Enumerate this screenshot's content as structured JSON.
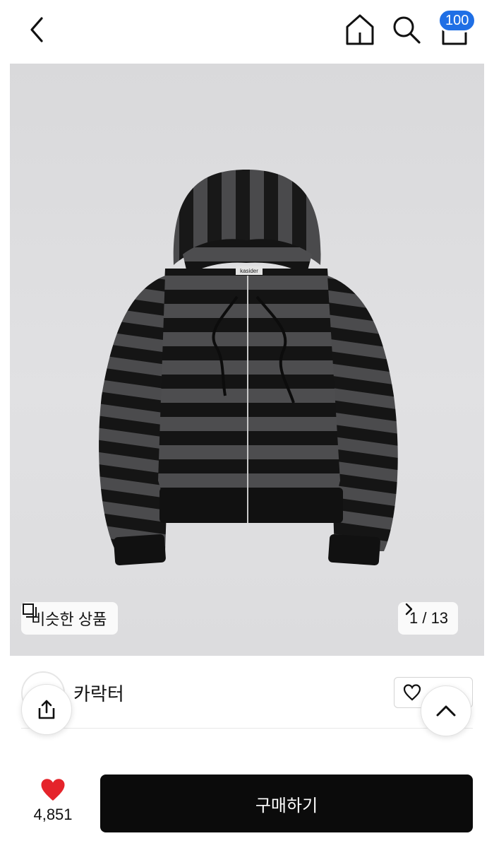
{
  "header": {
    "back_icon": "chevron-left-icon",
    "home_icon": "home-icon",
    "search_icon": "search-icon",
    "cart_icon": "cart-icon",
    "cart_badge": "100",
    "badge_color": "#1f6fe5"
  },
  "gallery": {
    "similar_label": "비슷한 상품",
    "page_indicator": "1 / 13",
    "tag_text": "kasider"
  },
  "brand": {
    "name": "카락터"
  },
  "colors": {
    "buy_button": "#0b0b0b",
    "heart": "#e5242b",
    "stripe_dark": "#141414",
    "stripe_grey": "#4d4d4f"
  },
  "bottom": {
    "wish_count": "4,851",
    "buy_label": "구매하기"
  }
}
